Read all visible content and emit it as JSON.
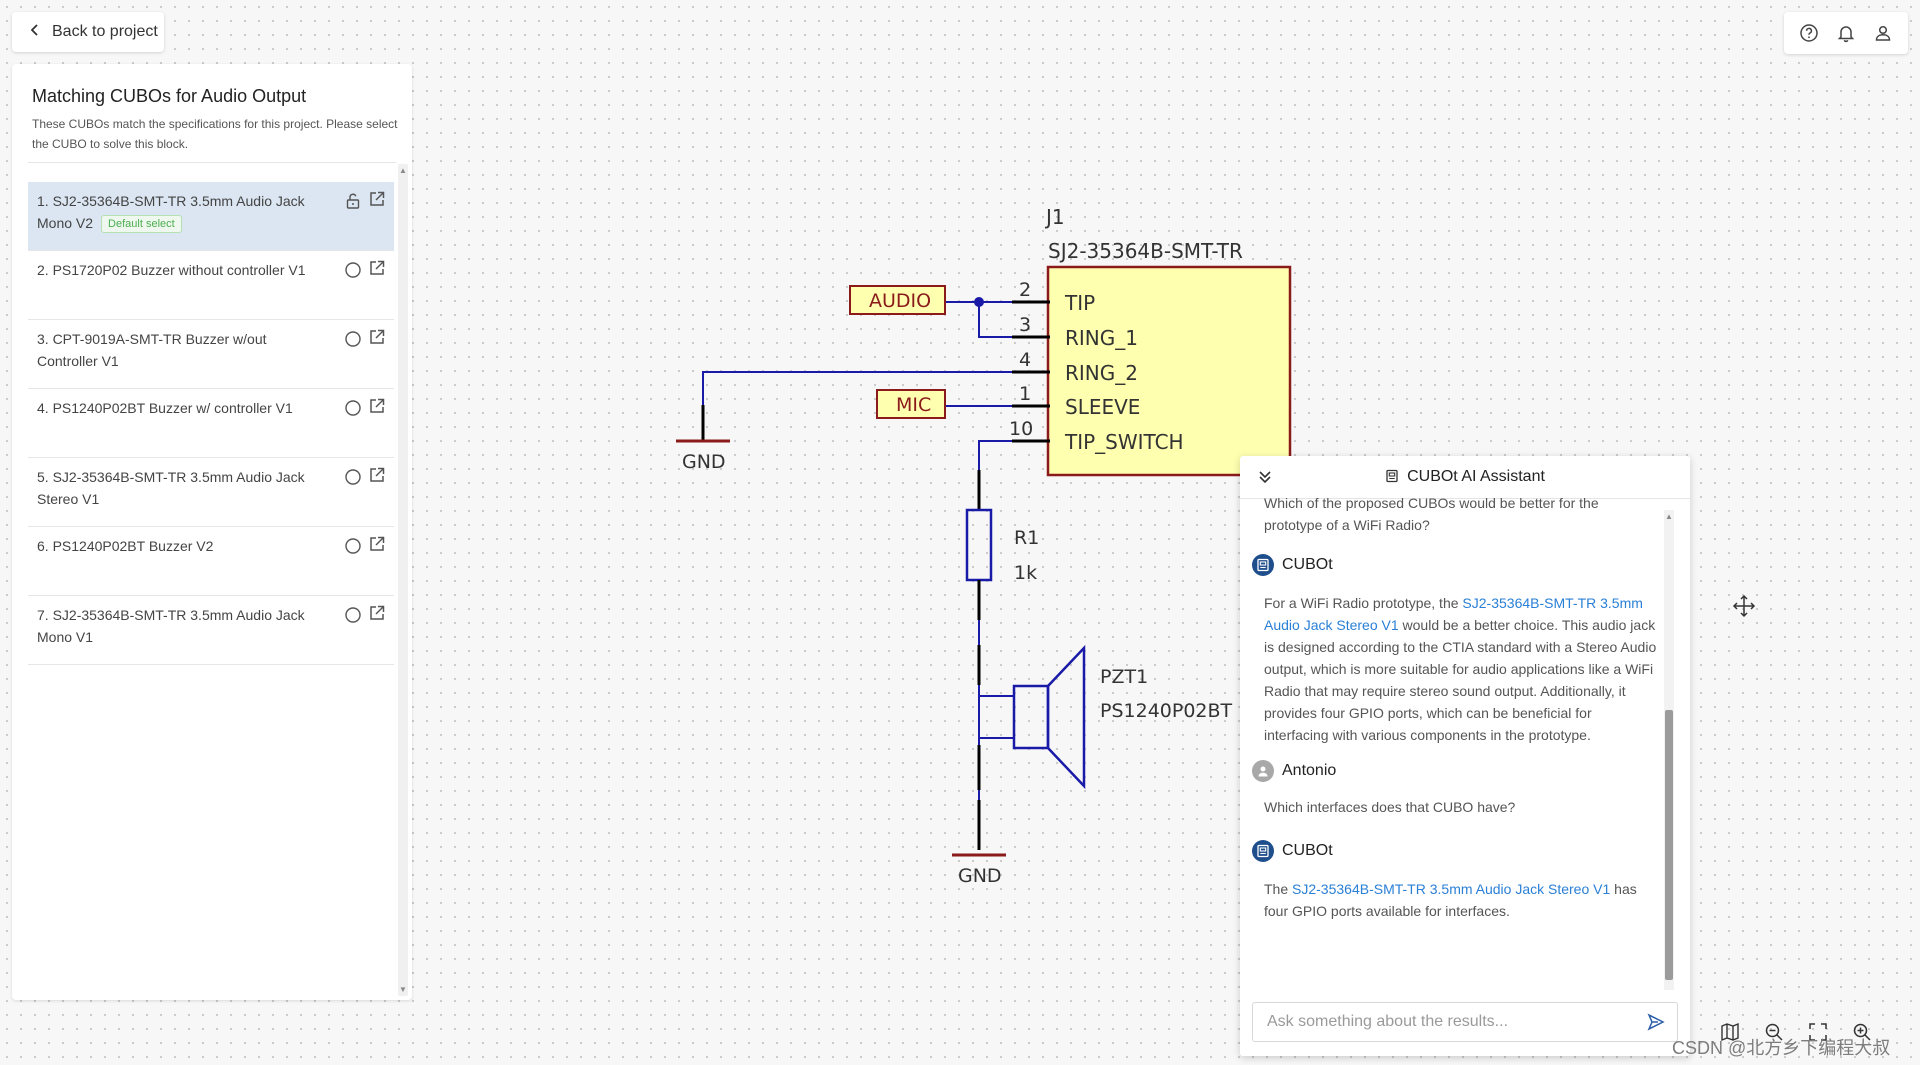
{
  "topbar": {
    "back_label": "Back to project"
  },
  "left_panel": {
    "title": "Matching CUBOs for Audio Output",
    "description": "These CUBOs match the specifications for this project. Please select the CUBO to solve this block.",
    "badge": "Default select",
    "items": [
      {
        "label": "1. SJ2-35364B-SMT-TR 3.5mm Audio Jack Mono V2",
        "selected": true
      },
      {
        "label": "2. PS1720P02 Buzzer without controller V1",
        "selected": false
      },
      {
        "label": "3. CPT-9019A-SMT-TR Buzzer w/out Controller V1",
        "selected": false
      },
      {
        "label": "4. PS1240P02BT Buzzer w/ controller V1",
        "selected": false
      },
      {
        "label": "5. SJ2-35364B-SMT-TR 3.5mm Audio Jack Stereo V1",
        "selected": false
      },
      {
        "label": "6. PS1240P02BT Buzzer V2",
        "selected": false
      },
      {
        "label": "7. SJ2-35364B-SMT-TR 3.5mm Audio Jack Mono V1",
        "selected": false
      }
    ]
  },
  "schematic": {
    "j1_ref": "J1",
    "j1_part": "SJ2-35364B-SMT-TR",
    "pins": [
      {
        "num": "2",
        "name": "TIP"
      },
      {
        "num": "3",
        "name": "RING_1"
      },
      {
        "num": "4",
        "name": "RING_2"
      },
      {
        "num": "1",
        "name": "SLEEVE"
      },
      {
        "num": "10",
        "name": "TIP_SWITCH"
      }
    ],
    "net_audio": "AUDIO",
    "net_mic": "MIC",
    "gnd_label": "GND",
    "r1_ref": "R1",
    "r1_value": "1k",
    "pzt_ref": "PZT1",
    "pzt_part": "PS1240P02BT",
    "colors": {
      "wire": "#1a1aa8",
      "component": "#8b1a1a",
      "fill": "#ffffb0",
      "gnd": "#8b1a1a"
    }
  },
  "assistant": {
    "title": "CUBOt AI Assistant",
    "prev_question": "Which of the proposed CUBOs would be better for the prototype of a WiFi Radio?",
    "messages": [
      {
        "author": "CUBOt",
        "text_before": "For a WiFi Radio prototype, the ",
        "link": "SJ2-35364B-SMT-TR 3.5mm Audio Jack Stereo V1",
        "text_after": " would be a better choice. This audio jack is designed according to the CTIA standard with a Stereo Audio output, which is more suitable for audio applications like a WiFi Radio that may require stereo sound output. Additionally, it provides four GPIO ports, which can be beneficial for interfacing with various components in the prototype."
      },
      {
        "author": "Antonio",
        "text": "Which interfaces does that CUBO have?"
      },
      {
        "author": "CUBOt",
        "text_before": "The ",
        "link": "SJ2-35364B-SMT-TR 3.5mm Audio Jack Stereo V1",
        "text_after": " has four GPIO ports available for interfaces."
      }
    ],
    "input_placeholder": "Ask something about the results...",
    "link_color": "#2a7fd6",
    "bot_avatar_color": "#1f4e8c",
    "user_avatar_color": "#a8a8a8"
  },
  "watermark": "CSDN @北方乡下编程大叔"
}
